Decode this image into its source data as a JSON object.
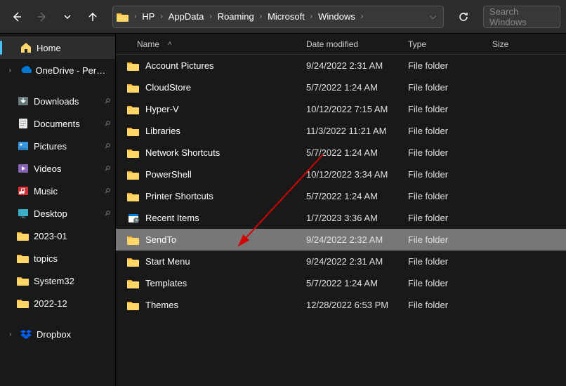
{
  "breadcrumb": {
    "items": [
      "HP",
      "AppData",
      "Roaming",
      "Microsoft",
      "Windows"
    ]
  },
  "search": {
    "placeholder": "Search Windows"
  },
  "sidebar": {
    "home": "Home",
    "onedrive": "OneDrive - Personal",
    "quick": [
      {
        "label": "Downloads",
        "icon": "download",
        "pinned": true
      },
      {
        "label": "Documents",
        "icon": "document",
        "pinned": true
      },
      {
        "label": "Pictures",
        "icon": "pictures",
        "pinned": true
      },
      {
        "label": "Videos",
        "icon": "videos",
        "pinned": true
      },
      {
        "label": "Music",
        "icon": "music",
        "pinned": true
      },
      {
        "label": "Desktop",
        "icon": "desktop",
        "pinned": true
      },
      {
        "label": "2023-01",
        "icon": "folder",
        "pinned": false
      },
      {
        "label": "topics",
        "icon": "folder",
        "pinned": false
      },
      {
        "label": "System32",
        "icon": "folder",
        "pinned": false
      },
      {
        "label": "2022-12",
        "icon": "folder",
        "pinned": false
      }
    ],
    "dropbox": "Dropbox"
  },
  "columns": {
    "name": "Name",
    "date": "Date modified",
    "type": "Type",
    "size": "Size"
  },
  "files": [
    {
      "name": "Account Pictures",
      "date": "9/24/2022 2:31 AM",
      "type": "File folder",
      "icon": "folder",
      "selected": false
    },
    {
      "name": "CloudStore",
      "date": "5/7/2022 1:24 AM",
      "type": "File folder",
      "icon": "folder",
      "selected": false
    },
    {
      "name": "Hyper-V",
      "date": "10/12/2022 7:15 AM",
      "type": "File folder",
      "icon": "folder",
      "selected": false
    },
    {
      "name": "Libraries",
      "date": "11/3/2022 11:21 AM",
      "type": "File folder",
      "icon": "folder",
      "selected": false
    },
    {
      "name": "Network Shortcuts",
      "date": "5/7/2022 1:24 AM",
      "type": "File folder",
      "icon": "folder",
      "selected": false
    },
    {
      "name": "PowerShell",
      "date": "10/12/2022 3:34 AM",
      "type": "File folder",
      "icon": "folder",
      "selected": false
    },
    {
      "name": "Printer Shortcuts",
      "date": "5/7/2022 1:24 AM",
      "type": "File folder",
      "icon": "folder",
      "selected": false
    },
    {
      "name": "Recent Items",
      "date": "1/7/2023 3:36 AM",
      "type": "File folder",
      "icon": "recent",
      "selected": false
    },
    {
      "name": "SendTo",
      "date": "9/24/2022 2:32 AM",
      "type": "File folder",
      "icon": "folder",
      "selected": true
    },
    {
      "name": "Start Menu",
      "date": "9/24/2022 2:31 AM",
      "type": "File folder",
      "icon": "folder",
      "selected": false
    },
    {
      "name": "Templates",
      "date": "5/7/2022 1:24 AM",
      "type": "File folder",
      "icon": "folder",
      "selected": false
    },
    {
      "name": "Themes",
      "date": "12/28/2022 6:53 PM",
      "type": "File folder",
      "icon": "folder",
      "selected": false
    }
  ]
}
